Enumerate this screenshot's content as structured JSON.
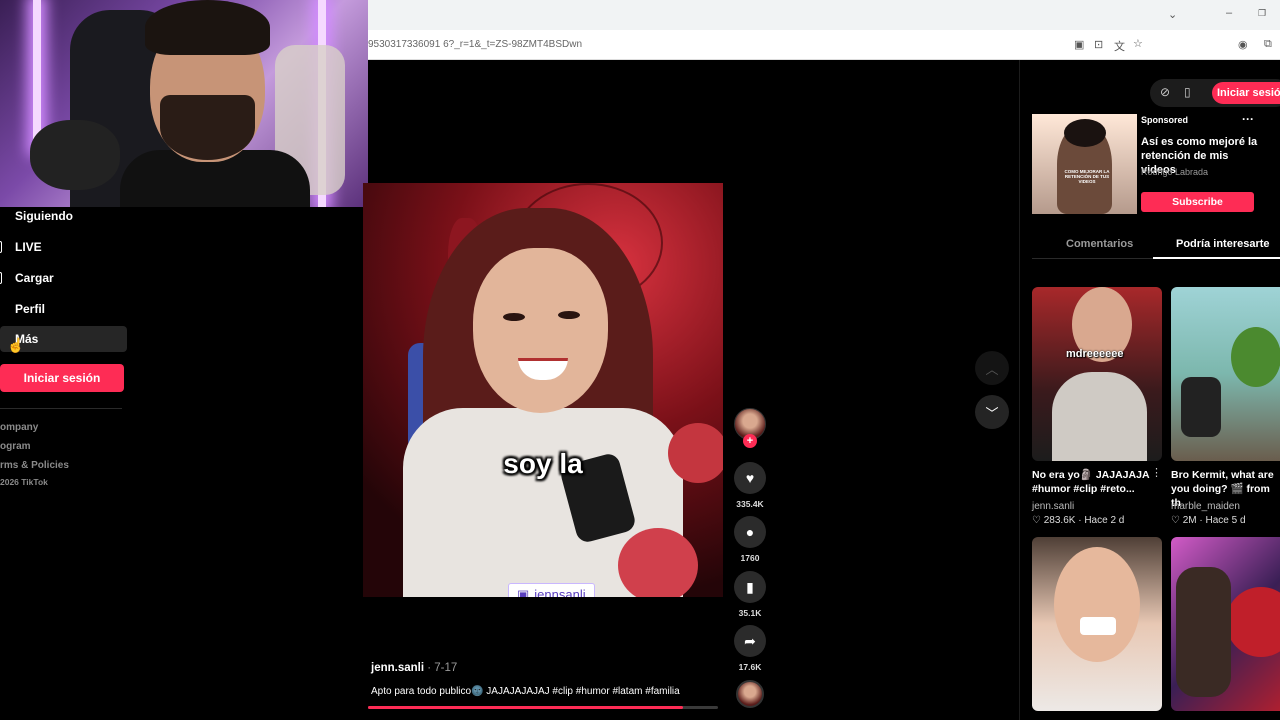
{
  "browser": {
    "url": "9530317336091 6?_r=1&_t=ZS-98ZMT4BSDwn"
  },
  "sidebar": {
    "items": [
      {
        "label": "Siguiendo"
      },
      {
        "label": "LIVE"
      },
      {
        "label": "Cargar"
      },
      {
        "label": "Perfil"
      },
      {
        "label": "Más"
      }
    ],
    "login_button": "Iniciar sesión",
    "footer_links": [
      "ompany",
      "ogram",
      "rms & Policies",
      "2026 TikTok"
    ]
  },
  "video": {
    "caption": "soy la",
    "watermark": "jennsanli",
    "author": "jenn.sanli",
    "date": " · 7-17",
    "description": "Apto para todo publico🌚 JAJAJAJAJAJ #clip #humor #latam #familia",
    "progress": 0.9
  },
  "actions": {
    "likes": "335.4K",
    "comments": "1760",
    "saves": "35.1K",
    "shares": "17.6K"
  },
  "right_panel": {
    "login_button": "Iniciar sesión",
    "ad": {
      "sponsored_label": "Sponsored",
      "title": "Así es como mejoré la retención de mis videos",
      "author": "Rodrigo Labrada",
      "subscribe_label": "Subscribe",
      "thumb_text": "COMO MEJORAR LA RETENCIÓN DE TUS VIDEOS"
    },
    "tabs": [
      {
        "label": "Comentarios",
        "active": false
      },
      {
        "label": "Podría interesarte",
        "active": true
      }
    ],
    "cards": [
      {
        "thumb_text": "mdreeeeee",
        "title": "No era yo🗿 JAJAJAJA #humor #clip #reto...",
        "author": "jenn.sanli",
        "stats": "♡ 283.6K · Hace 2 d"
      },
      {
        "thumb_text": "",
        "title": "Bro Kermit, what are you doing? 🎬 from th",
        "author": "marble_maiden",
        "stats": "♡ 2M · Hace 5 d"
      },
      {
        "thumb_text": "",
        "title": "",
        "author": "",
        "stats": ""
      },
      {
        "thumb_text": "",
        "title": "",
        "author": "",
        "stats": ""
      }
    ]
  },
  "colors": {
    "accent": "#fe2c55",
    "background": "#000000"
  }
}
